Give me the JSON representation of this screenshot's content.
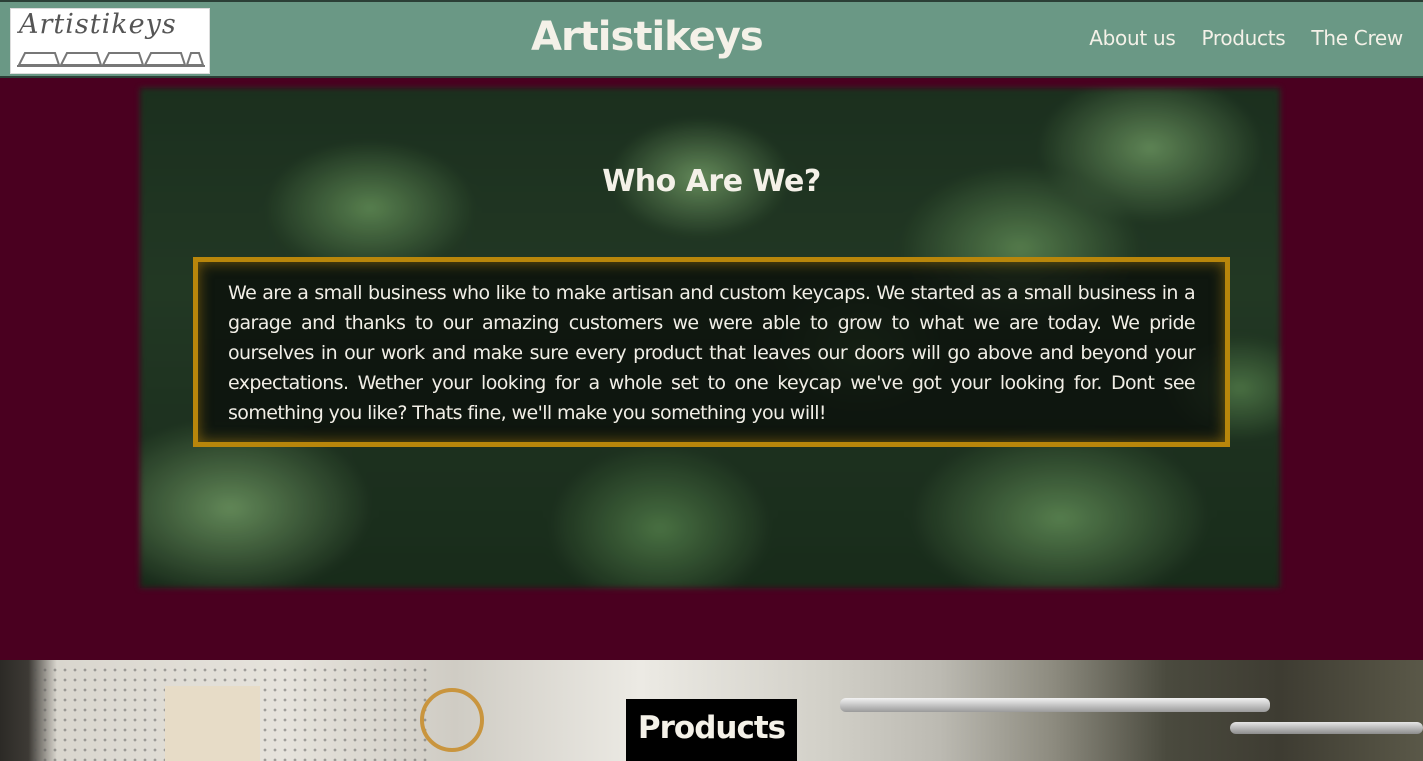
{
  "header": {
    "logo_text": "Artistikeys",
    "title": "Artistikeys",
    "nav": [
      {
        "label": "About us"
      },
      {
        "label": "Products"
      },
      {
        "label": "The Crew"
      }
    ]
  },
  "about": {
    "heading": "Who Are We?",
    "body": "We are a small business who like to make artisan and custom keycaps. We started as a small business in a garage and thanks to our amazing customers we were able to grow to what we are today. We pride ourselves in our work and make sure every product that leaves our doors will go above and beyond your expectations. Wether your looking for a whole set to one keycap we've got your looking for. Dont see something you like? Thats fine, we'll make you something you will!"
  },
  "products": {
    "heading": "Products"
  },
  "colors": {
    "header_bg": "#6a9885",
    "page_bg": "#4a0020",
    "box_border": "#b8860b",
    "text_light": "#f4f1e8"
  }
}
